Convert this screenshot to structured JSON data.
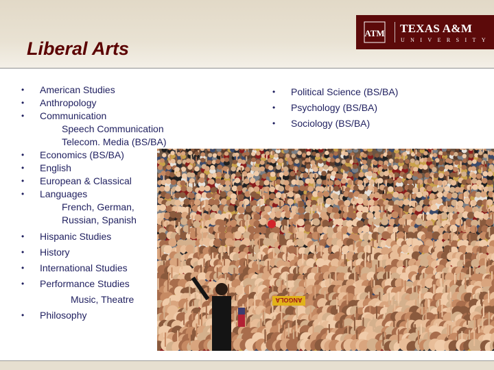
{
  "slide": {
    "title": "Liberal Arts"
  },
  "logo": {
    "line1": "TEXAS A&M",
    "line2": "UNIVERSITY",
    "mark": "ATM",
    "color": "#5c0a0a"
  },
  "left_list": [
    {
      "text": "American Studies",
      "bullet": true
    },
    {
      "text": "Anthropology",
      "bullet": true
    },
    {
      "text": "Communication",
      "bullet": true
    },
    {
      "text": "Speech Communication",
      "bullet": false
    },
    {
      "text": "Telecom. Media (BS/BA)",
      "bullet": false
    },
    {
      "text": "Economics (BS/BA)",
      "bullet": true
    },
    {
      "text": "English",
      "bullet": true
    },
    {
      "text": "European & Classical",
      "bullet": true
    },
    {
      "text": "Languages",
      "bullet": true
    },
    {
      "text": "French, German,",
      "bullet": false
    },
    {
      "text": "Russian, Spanish",
      "bullet": false
    },
    {
      "text": "Hispanic Studies",
      "bullet": true
    },
    {
      "text": "History",
      "bullet": true
    },
    {
      "text": "International Studies",
      "bullet": true
    },
    {
      "text": "Performance Studies",
      "bullet": true
    },
    {
      "text": "Music, Theatre",
      "bullet": false
    },
    {
      "text": "Philosophy",
      "bullet": true
    }
  ],
  "right_list": [
    {
      "text": "Political Science (BS/BA)",
      "bullet": true
    },
    {
      "text": "Psychology (BS/BA)",
      "bullet": true
    },
    {
      "text": "Sociology (BS/BA)",
      "bullet": true
    }
  ],
  "photo": {
    "sign_text": "ANGOLA",
    "subject": "crowd-photo"
  },
  "colors": {
    "title": "#5b0000",
    "list_text": "#1f1f5f",
    "header_bg": "#e2d9c7"
  }
}
